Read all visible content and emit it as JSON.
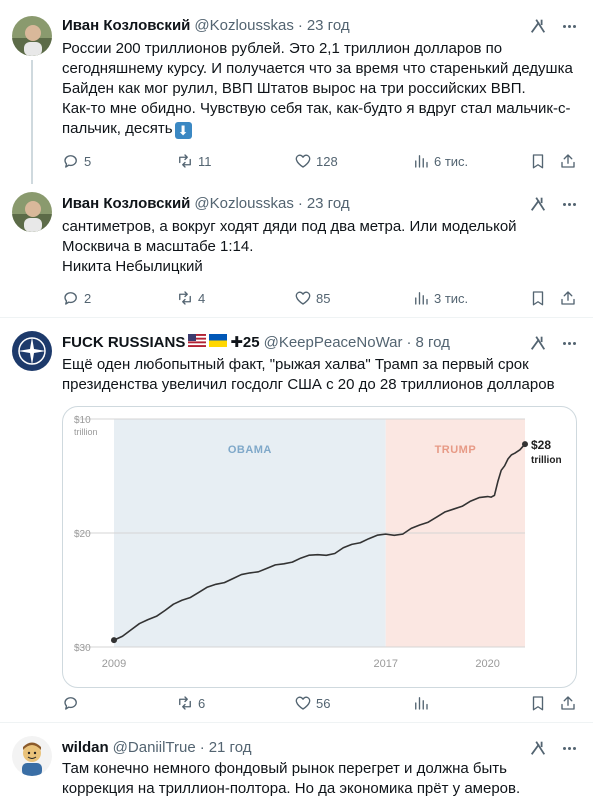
{
  "tweets": [
    {
      "name": "Иван Козловский",
      "handle": "@Kozlousskas",
      "time": "23 год",
      "lines": [
        "России 200 триллионов рублей. Это 2,1 триллион долларов по",
        "сегодняшнему курсу. И получается что за время что старенький дедушка",
        "Байден как мог рулил, ВВП Штатов вырос на три российских ВВП.",
        "Как-то мне обидно. Чувствую себя так, как-будто я вдруг стал мальчик-с-",
        "пальчик, десять"
      ],
      "emoji": "⬇",
      "replies": "5",
      "reposts": "11",
      "likes": "128",
      "views": "6 тис."
    },
    {
      "name": "Иван Козловский",
      "handle": "@Kozlousskas",
      "time": "23 год",
      "lines": [
        "сантиметров, а вокруг ходят дяди под два метра. Или моделькой",
        "Москвича в масштабе 1:14.",
        "Никита Небылицкий"
      ],
      "replies": "2",
      "reposts": "4",
      "likes": "85",
      "views": "3 тис."
    },
    {
      "name": "FUCK RUSSIANS",
      "name_suffix": "✚25",
      "handle": "@KeepPeaceNoWar",
      "time": "8 год",
      "lines": [
        "Ещё оден любопытный факт, \"рыжая халва\" Трамп за первый срок",
        "президенства увеличил госдолг США с 20 до 28 триллионов долларов"
      ],
      "replies": "",
      "reposts": "6",
      "likes": "56",
      "views": "",
      "chart_data": {
        "type": "line",
        "title": "",
        "xlabel": "",
        "ylabel": "",
        "x_ticks": [
          "2009",
          "2017",
          "2020"
        ],
        "y_ticks": [
          "$10",
          "$20",
          "$30"
        ],
        "y_unit_label": "trillion",
        "ylim": [
          10,
          30
        ],
        "xlim": [
          2009,
          2021.1
        ],
        "regions": [
          {
            "label": "OBAMA",
            "from": 2009,
            "to": 2017,
            "color": "#e7eef3"
          },
          {
            "label": "TRUMP",
            "from": 2017,
            "to": 2021.1,
            "color": "#fbe7e2"
          }
        ],
        "end_label": "$28",
        "end_label_unit": "trillion",
        "series": [
          {
            "x": [
              2009.0,
              2009.5,
              2010.0,
              2010.5,
              2011.0,
              2011.5,
              2012.0,
              2012.5,
              2013.0,
              2013.5,
              2014.0,
              2014.5,
              2015.0,
              2015.5,
              2016.0,
              2016.5,
              2017.0,
              2017.5,
              2018.0,
              2018.5,
              2019.0,
              2019.5,
              2020.0,
              2020.2,
              2020.4,
              2020.6,
              2020.8,
              2021.1
            ],
            "y": [
              10.6,
              11.5,
              12.4,
              13.2,
              14.1,
              14.8,
              15.5,
              16.0,
              16.5,
              16.9,
              17.3,
              17.8,
              18.1,
              18.2,
              19.0,
              19.5,
              19.9,
              19.9,
              20.7,
              21.4,
              22.1,
              22.8,
              23.2,
              23.3,
              25.5,
              26.5,
              27.0,
              27.8
            ]
          }
        ]
      }
    },
    {
      "name": "wildan",
      "handle": "@DaniilTrue",
      "time": "21 год",
      "lines": [
        "Там конечно немного фондовый рынок перегрет и должна быть",
        "коррекция на триллион-полтора. Но да экономика прёт у амеров."
      ]
    }
  ],
  "colors": {
    "text": "#0f1419",
    "muted": "#536471",
    "border": "#eff3f4",
    "obama": "#e7eef3",
    "trump": "#fbe7e2",
    "line": "#333333",
    "emoji_blue": "#3b88c3"
  }
}
